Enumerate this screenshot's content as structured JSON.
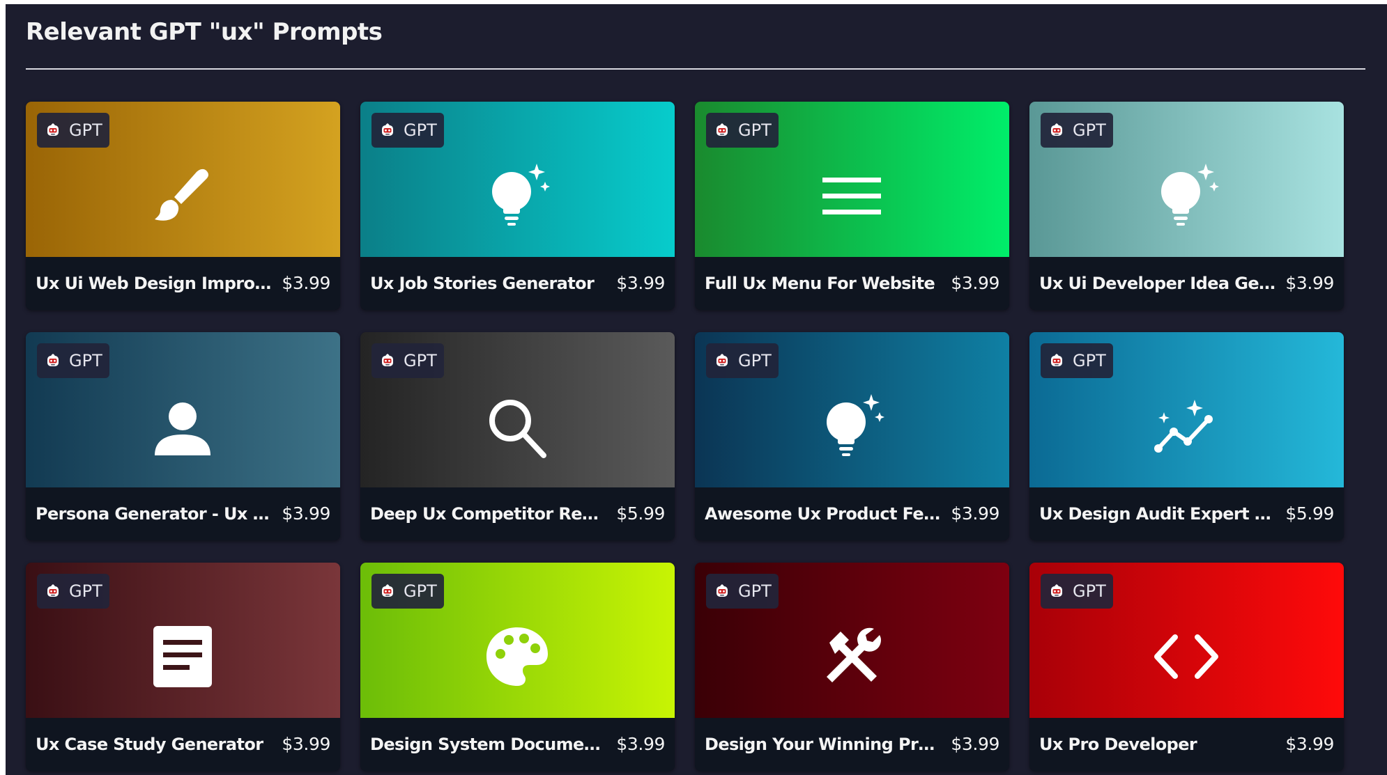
{
  "section": {
    "title": "Relevant GPT \"ux\" Prompts"
  },
  "badge_label": "GPT",
  "cards": [
    {
      "title": "Ux Ui Web Design Improvement",
      "price": "$3.99",
      "icon": "brush-icon",
      "gradient": [
        "#9a6506",
        "#d4a220"
      ]
    },
    {
      "title": "Ux Job Stories Generator",
      "price": "$3.99",
      "icon": "lightbulb-icon",
      "gradient": [
        "#0b7f88",
        "#07cccc"
      ]
    },
    {
      "title": "Full Ux Menu For Website",
      "price": "$3.99",
      "icon": "menu-icon",
      "gradient": [
        "#1a8a2e",
        "#00ee6a"
      ]
    },
    {
      "title": "Ux Ui Developer Idea Generator",
      "price": "$3.99",
      "icon": "lightbulb-icon",
      "gradient": [
        "#5a9896",
        "#a8e2e0"
      ]
    },
    {
      "title": "Persona Generator - Ux User ...",
      "price": "$3.99",
      "icon": "person-icon",
      "gradient": [
        "#123a52",
        "#3d7287"
      ]
    },
    {
      "title": "Deep Ux Competitor Review A...",
      "price": "$5.99",
      "icon": "search-icon",
      "gradient": [
        "#242424",
        "#5a5a5a"
      ]
    },
    {
      "title": "Awesome Ux Product Feature ...",
      "price": "$3.99",
      "icon": "lightbulb-icon",
      "gradient": [
        "#0b3554",
        "#0f80a4"
      ]
    },
    {
      "title": "Ux Design Audit Expert App R...",
      "price": "$5.99",
      "icon": "analytics-icon",
      "gradient": [
        "#0b6a94",
        "#24b8d9"
      ]
    },
    {
      "title": "Ux Case Study Generator",
      "price": "$3.99",
      "icon": "document-icon",
      "gradient": [
        "#3a0f14",
        "#7a363a"
      ]
    },
    {
      "title": "Design System Documentatio...",
      "price": "$3.99",
      "icon": "palette-icon",
      "gradient": [
        "#6cbd08",
        "#c8f404"
      ]
    },
    {
      "title": "Design Your Winning Product ...",
      "price": "$3.99",
      "icon": "tools-icon",
      "gradient": [
        "#3a0006",
        "#7e0010"
      ]
    },
    {
      "title": "Ux Pro Developer",
      "price": "$3.99",
      "icon": "code-icon",
      "gradient": [
        "#a80008",
        "#ff0a0a"
      ]
    }
  ]
}
